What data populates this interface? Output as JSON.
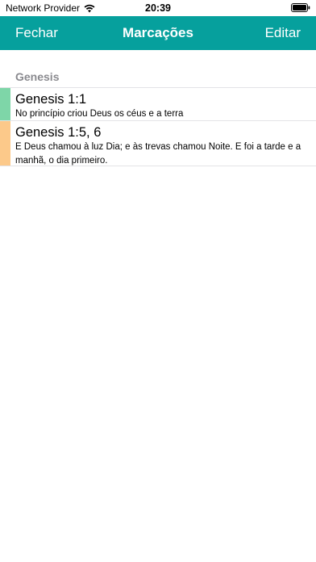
{
  "status_bar": {
    "carrier": "Network Provider",
    "time": "20:39"
  },
  "nav": {
    "left_label": "Fechar",
    "title": "Marcações",
    "right_label": "Editar",
    "background_color": "#06a09d"
  },
  "section": {
    "title": "Genesis"
  },
  "bookmarks": [
    {
      "reference": "Genesis 1:1",
      "text": "No princípio criou Deus os céus e a terra",
      "color": "#7ed6a8"
    },
    {
      "reference": "Genesis 1:5, 6",
      "text": "E Deus chamou à luz Dia; e às trevas chamou Noite. E foi a tarde e a manhã, o dia primeiro.",
      "color": "#fcc98a"
    }
  ]
}
